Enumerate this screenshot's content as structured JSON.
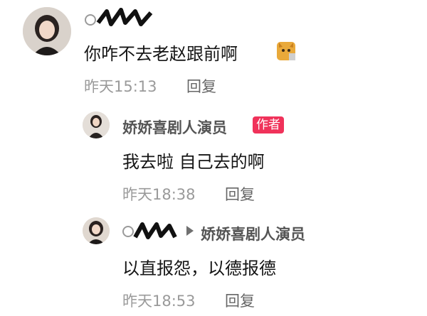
{
  "comments": [
    {
      "text": "你咋不去老赵跟前啊",
      "emoji_icon": "cat-face-emoji",
      "time": "昨天15:13",
      "reply_label": "回复"
    }
  ],
  "replies": [
    {
      "username": "娇娇喜剧人演员",
      "badge": "作者",
      "text": "我去啦 自己去的啊",
      "time": "昨天18:38",
      "reply_label": "回复"
    },
    {
      "reply_to": "娇娇喜剧人演员",
      "text": "以直报怨，以德报德",
      "time": "昨天18:53",
      "reply_label": "回复"
    }
  ],
  "colors": {
    "badge": "#f0325a",
    "meta_gray": "#9a9a9a",
    "reply_gray": "#666666"
  }
}
